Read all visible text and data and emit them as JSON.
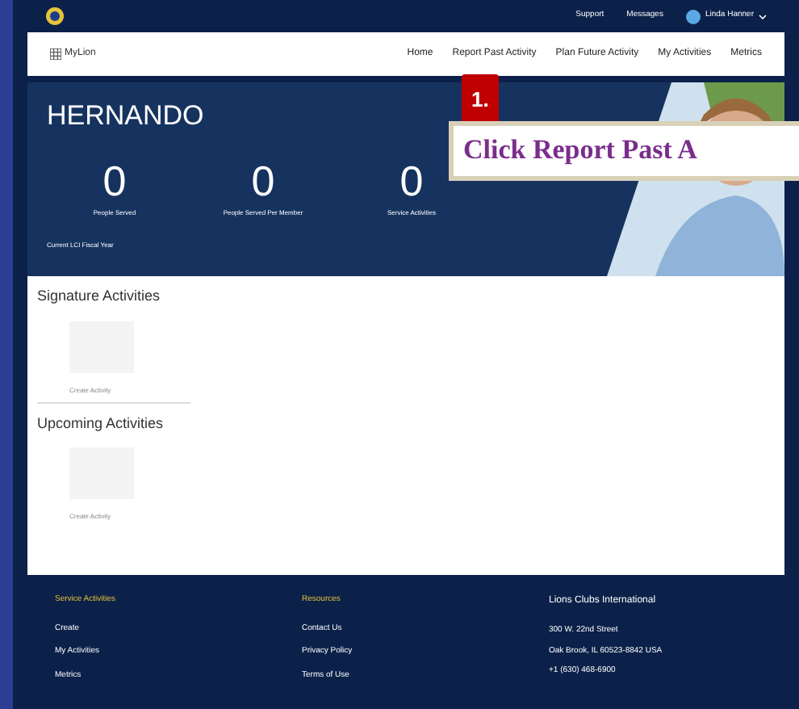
{
  "top_bar": {
    "links": [
      "Support",
      "Messages"
    ],
    "user": "Linda Hanner"
  },
  "nav": {
    "brand": "MyLion",
    "items": [
      {
        "label": "Home",
        "selected": false
      },
      {
        "label": "Report Past Activity",
        "selected": false
      },
      {
        "label": "Plan Future Activity",
        "selected": false
      },
      {
        "label": "My Activities",
        "selected": false
      },
      {
        "label": "Metrics",
        "selected": false
      }
    ]
  },
  "hero": {
    "club": "HERNANDO",
    "stats": [
      {
        "value": "0",
        "label": "People Served"
      },
      {
        "value": "0",
        "label": "People Served Per Member"
      },
      {
        "value": "0",
        "label": "Service Activities"
      }
    ],
    "note": "Current LCI Fiscal Year"
  },
  "callout": {
    "step": "1.",
    "text": "Click Report Past A"
  },
  "sections": [
    {
      "title": "Signature Activities",
      "action": "Create Activity"
    },
    {
      "title": "Upcoming Activities",
      "action": "Create Activity"
    }
  ],
  "footer": {
    "columns": [
      {
        "heading": "Service Activities",
        "links": [
          "Create",
          "My Activities",
          "Metrics"
        ]
      },
      {
        "heading": "Resources",
        "links": [
          "Contact Us",
          "Privacy Policy",
          "Terms of Use"
        ]
      }
    ],
    "org": {
      "name": "Lions Clubs International",
      "lines": [
        "300 W. 22nd Street",
        "Oak Brook, IL 60523-8842 USA",
        "+1 (630) 468-6900"
      ]
    }
  }
}
